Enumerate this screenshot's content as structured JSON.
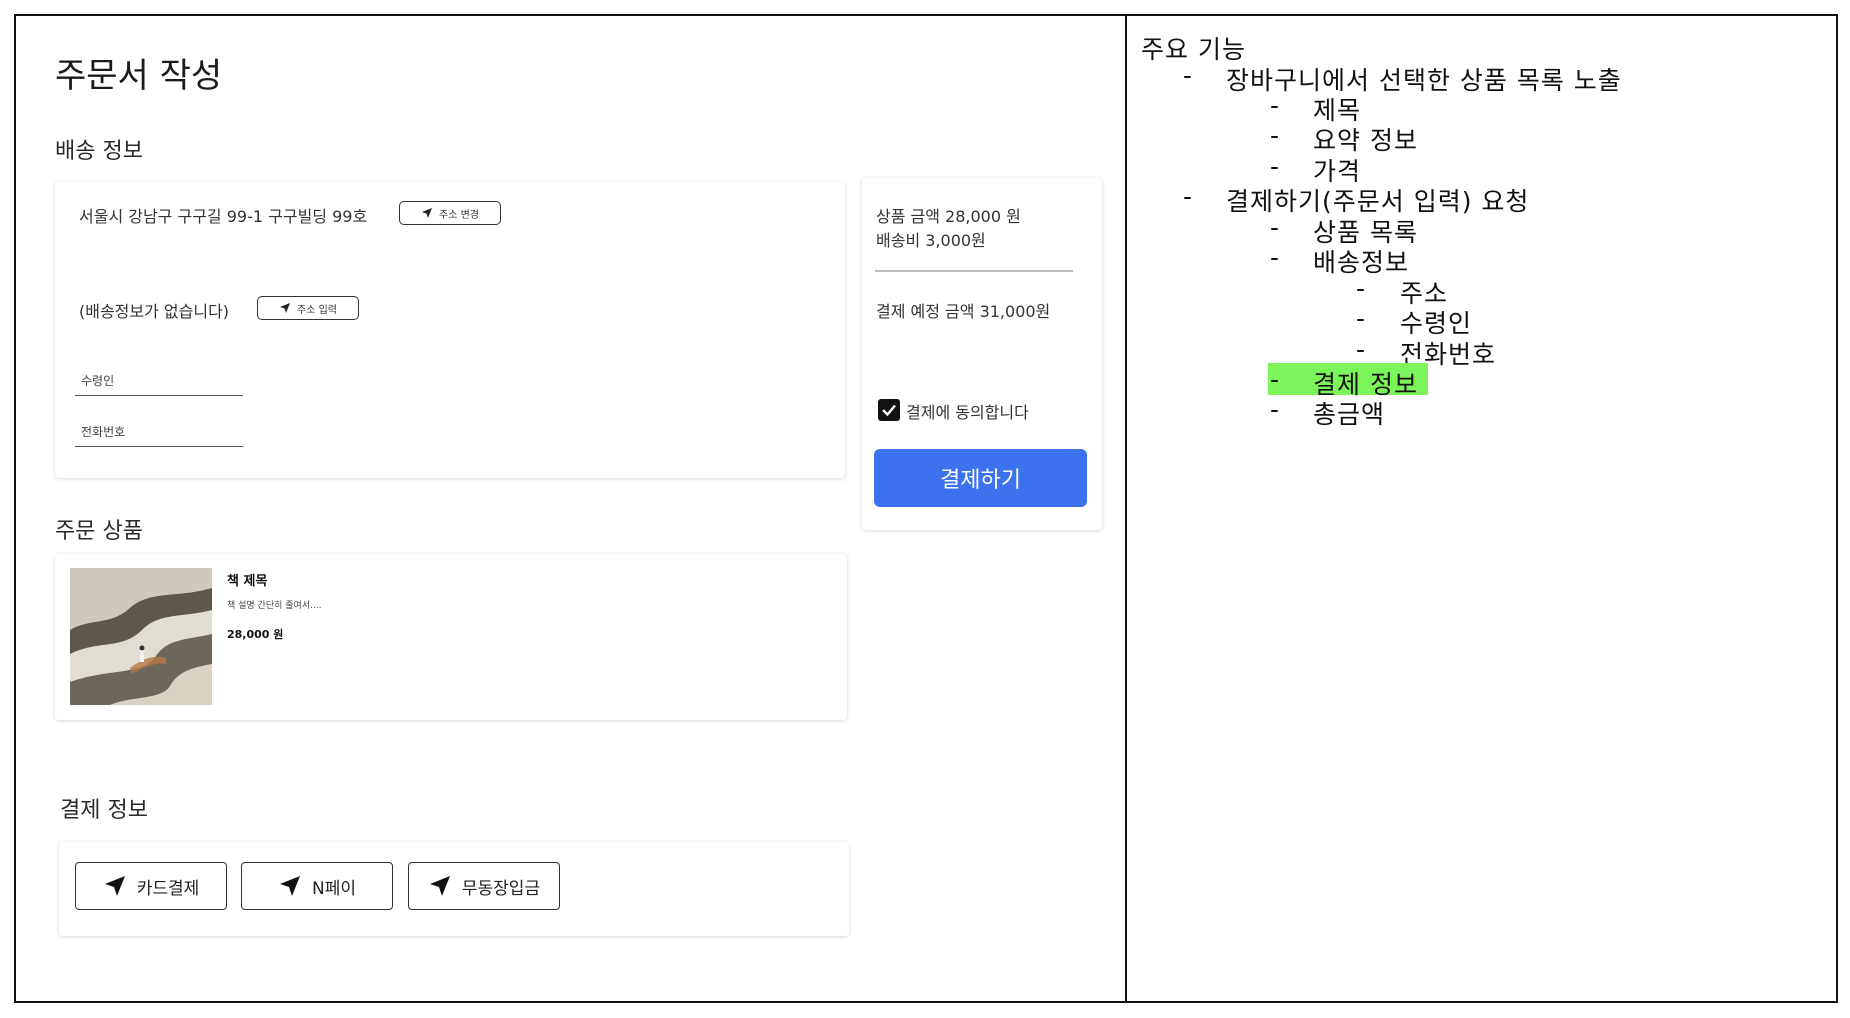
{
  "page": {
    "title": "주문서 작성"
  },
  "shipping": {
    "section_title": "배송 정보",
    "address": "서울시 강남구 구구길 99-1 구구빌딩 99호",
    "change_address_label": "주소 변경",
    "empty_text": "(배송정보가 없습니다)",
    "input_address_label": "주소 입력",
    "recipient_label": "수령인",
    "phone_label": "전화번호"
  },
  "summary": {
    "product_amount": "상품 금액 28,000 원",
    "shipping_fee": "배송비 3,000원",
    "expected_total": "결제 예정 금액 31,000원",
    "agree_label": "결제에 동의합니다",
    "agree_checked": true,
    "pay_button": "결제하기"
  },
  "order_items": {
    "section_title": "주문 상품",
    "items": [
      {
        "title": "책 제목",
        "description": "책 설명 간단히 줄여서....",
        "price": "28,000 원"
      }
    ]
  },
  "payment": {
    "section_title": "결제 정보",
    "methods": [
      {
        "label": "카드결제",
        "icon": "navigation-arrow-icon"
      },
      {
        "label": "N페이",
        "icon": "navigation-arrow-icon"
      },
      {
        "label": "무동장입금",
        "icon": "navigation-arrow-icon"
      }
    ]
  },
  "notes": {
    "title": "주요 기능",
    "items": [
      {
        "text": "장바구니에서 선택한 상품 목록 노출",
        "level": 1,
        "highlight": false
      },
      {
        "text": "제목",
        "level": 2,
        "highlight": false
      },
      {
        "text": "요약 정보",
        "level": 2,
        "highlight": false
      },
      {
        "text": "가격",
        "level": 2,
        "highlight": false
      },
      {
        "text": "결제하기(주문서 입력) 요청",
        "level": 1,
        "highlight": false
      },
      {
        "text": "상품 목록",
        "level": 2,
        "highlight": false
      },
      {
        "text": "배송정보",
        "level": 2,
        "highlight": false
      },
      {
        "text": "주소",
        "level": 3,
        "highlight": false
      },
      {
        "text": "수령인",
        "level": 3,
        "highlight": false
      },
      {
        "text": "전화번호",
        "level": 3,
        "highlight": false
      },
      {
        "text": "결제 정보",
        "level": 2,
        "highlight": true
      },
      {
        "text": "총금액",
        "level": 2,
        "highlight": false
      }
    ],
    "bullet": "-",
    "highlight_color": "#7cf55a"
  },
  "colors": {
    "primary": "#3d72ee"
  }
}
